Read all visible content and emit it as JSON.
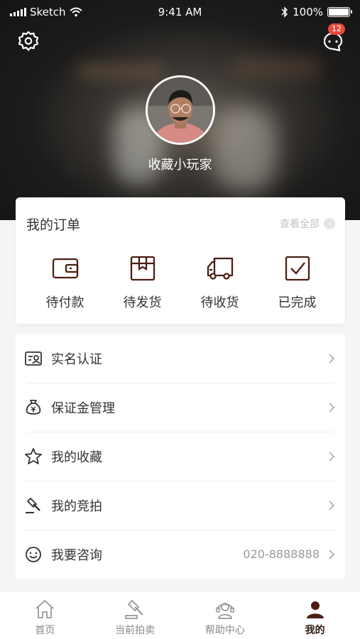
{
  "status_bar": {
    "carrier": "Sketch",
    "time": "9:41 AM",
    "battery": "100%"
  },
  "header": {
    "nickname": "收藏小玩家",
    "message_count": "12"
  },
  "orders": {
    "title": "我的订单",
    "view_all": "查看全部",
    "items": [
      {
        "label": "待付款",
        "icon": "wallet-icon"
      },
      {
        "label": "待发货",
        "icon": "package-icon"
      },
      {
        "label": "待收货",
        "icon": "truck-icon"
      },
      {
        "label": "已完成",
        "icon": "checkbox-icon"
      }
    ]
  },
  "menu": [
    {
      "label": "实名认证",
      "icon": "id-card-icon"
    },
    {
      "label": "保证金管理",
      "icon": "money-bag-icon"
    },
    {
      "label": "我的收藏",
      "icon": "star-icon"
    },
    {
      "label": "我的竞拍",
      "icon": "gavel-icon"
    },
    {
      "label": "我要咨询",
      "icon": "smile-icon",
      "value": "020-8888888"
    }
  ],
  "tabbar": [
    {
      "label": "首页",
      "icon": "home-icon"
    },
    {
      "label": "当前拍卖",
      "icon": "gavel-icon"
    },
    {
      "label": "帮助中心",
      "icon": "headset-icon"
    },
    {
      "label": "我的",
      "icon": "person-icon",
      "active": true
    }
  ],
  "colors": {
    "accent": "#4a1e12",
    "badge": "#e74b3c"
  }
}
